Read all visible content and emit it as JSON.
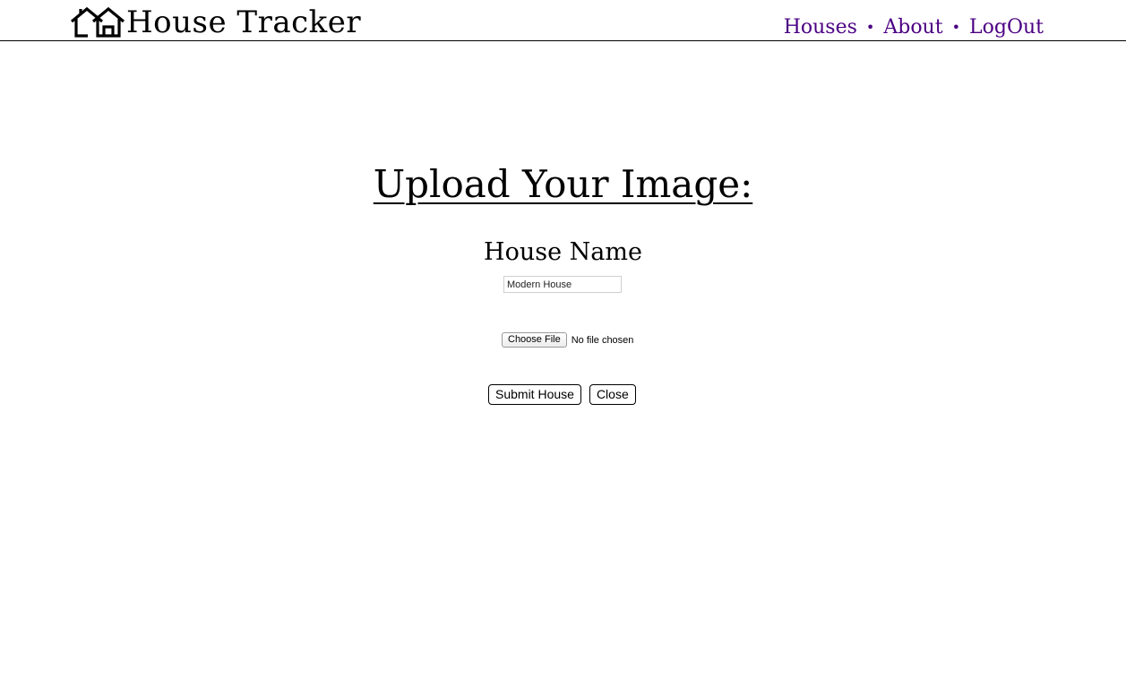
{
  "header": {
    "logo_icon": "houses-icon",
    "title": "House Tracker",
    "nav": [
      {
        "label": "Houses"
      },
      {
        "label": "About"
      },
      {
        "label": "LogOut"
      }
    ],
    "nav_separator": "•",
    "nav_color": "#4b0082"
  },
  "main": {
    "heading": "Upload Your Image:",
    "house_name_label": "House Name",
    "house_name_value": "Modern House",
    "file_button_label": "Choose File",
    "file_status": "No file chosen",
    "submit_label": "Submit House",
    "close_label": "Close"
  }
}
